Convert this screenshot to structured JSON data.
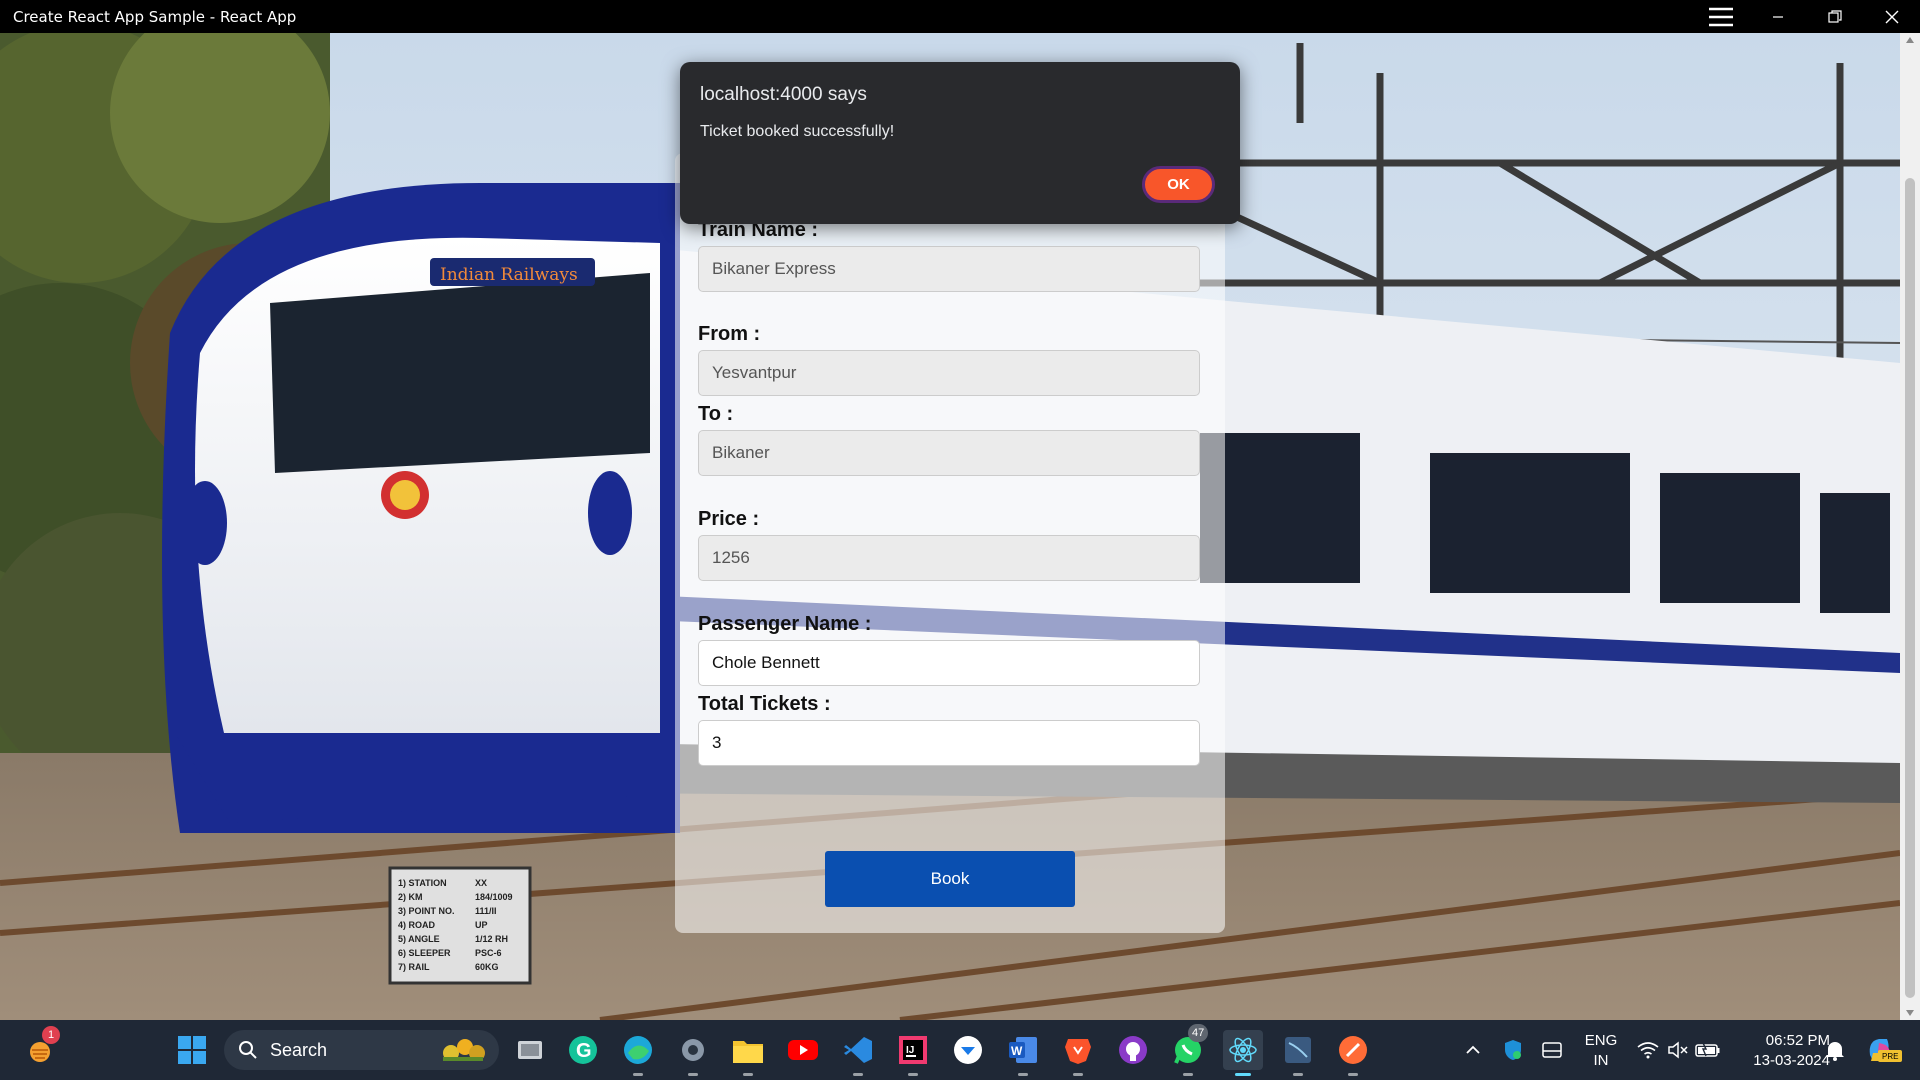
{
  "window": {
    "title": "Create React App Sample - React App"
  },
  "background": {
    "sign_lines": [
      "1) STATION",
      "2) KM",
      "3) POINT NO.",
      "4) ROAD",
      "5) ANGLE",
      "6) SLEEPER",
      "7) RAIL"
    ],
    "sign_values": [
      "XX",
      "184/1009",
      "111/II",
      "UP",
      "1/12 RH",
      "PSC-6",
      "60KG"
    ],
    "train_logo_text": "Indian Railways"
  },
  "form": {
    "train_name_label": "Train Name :",
    "train_name_value": "Bikaner Express",
    "from_label": "From :",
    "from_value": "Yesvantpur",
    "to_label": "To :",
    "to_value": "Bikaner",
    "price_label": "Price :",
    "price_value": "1256",
    "passenger_label": "Passenger Name :",
    "passenger_value": "Chole Bennett",
    "tickets_label": "Total Tickets :",
    "tickets_value": "3",
    "book_label": "Book"
  },
  "dialog": {
    "title": "localhost:4000 says",
    "message": "Ticket booked successfully!",
    "ok_label": "OK"
  },
  "taskbar": {
    "search_label": "Search",
    "weather_badge": "1",
    "whatsapp_badge": "47",
    "lang_top": "ENG",
    "lang_bottom": "IN",
    "time": "06:52 PM",
    "date": "13-03-2024",
    "pre_label": "PRE"
  },
  "colors": {
    "book_button": "#0a4fb0",
    "ok_button": "#f8562a",
    "dialog_bg": "#292a2d",
    "taskbar_bg": "#1f2836"
  }
}
